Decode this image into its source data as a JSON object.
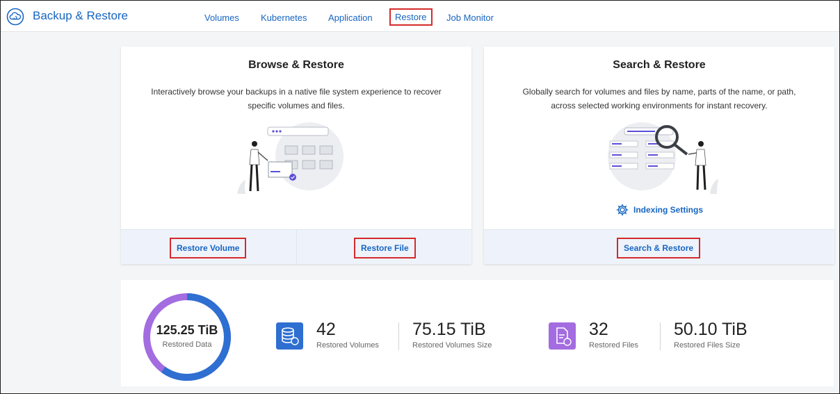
{
  "header": {
    "title": "Backup & Restore",
    "icon": "cloud-refresh-icon",
    "tabs": [
      {
        "label": "Volumes"
      },
      {
        "label": "Kubernetes"
      },
      {
        "label": "Application"
      },
      {
        "label": "Restore",
        "active": true
      },
      {
        "label": "Job Monitor"
      }
    ]
  },
  "browse_card": {
    "title": "Browse & Restore",
    "description": "Interactively browse your backups in a native file system experience to recover specific volumes and files.",
    "restore_volume_label": "Restore Volume",
    "restore_file_label": "Restore File"
  },
  "search_card": {
    "title": "Search & Restore",
    "description": "Globally search for volumes and files by name, parts of the name, or path, across selected working environments for instant recovery.",
    "indexing_label": "Indexing Settings",
    "search_restore_label": "Search & Restore"
  },
  "stats": {
    "total_value": "125.25 TiB",
    "total_label": "Restored Data",
    "volumes_count": "42",
    "volumes_label": "Restored Volumes",
    "volumes_size": "75.15 TiB",
    "volumes_size_label": "Restored Volumes Size",
    "files_count": "32",
    "files_label": "Restored Files",
    "files_size": "50.10 TiB",
    "files_size_label": "Restored Files Size",
    "volumes_share": 0.6,
    "files_share": 0.4
  },
  "colors": {
    "accent": "#1765c1",
    "highlight": "#d42a2a",
    "volume_blue": "#2e6fd1",
    "file_purple": "#a36ce0"
  }
}
